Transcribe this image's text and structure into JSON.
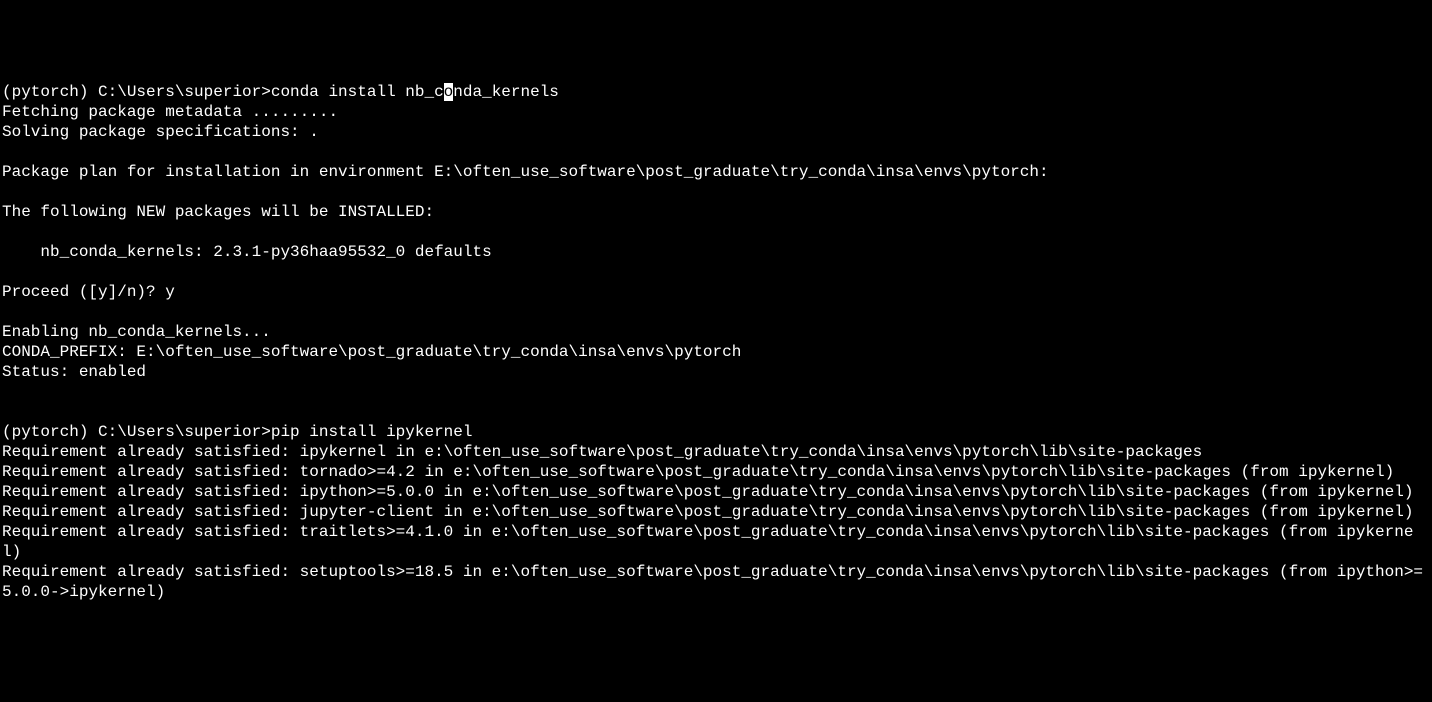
{
  "terminal": {
    "lines": [
      {
        "prompt": "(pytorch) C:\\Users\\superior>",
        "command_before_cursor": "conda install nb_c",
        "cursor_char": "o",
        "command_after_cursor": "nda_kernels"
      },
      {
        "text": "Fetching package metadata ........."
      },
      {
        "text": "Solving package specifications: ."
      },
      {
        "text": ""
      },
      {
        "text": "Package plan for installation in environment E:\\often_use_software\\post_graduate\\try_conda\\insa\\envs\\pytorch:"
      },
      {
        "text": ""
      },
      {
        "text": "The following NEW packages will be INSTALLED:"
      },
      {
        "text": ""
      },
      {
        "text": "    nb_conda_kernels: 2.3.1-py36haa95532_0 defaults"
      },
      {
        "text": ""
      },
      {
        "text": "Proceed ([y]/n)? y"
      },
      {
        "text": ""
      },
      {
        "text": "Enabling nb_conda_kernels..."
      },
      {
        "text": "CONDA_PREFIX: E:\\often_use_software\\post_graduate\\try_conda\\insa\\envs\\pytorch"
      },
      {
        "text": "Status: enabled"
      },
      {
        "text": ""
      },
      {
        "text": ""
      },
      {
        "prompt": "(pytorch) C:\\Users\\superior>",
        "command": "pip install ipykernel"
      },
      {
        "text": "Requirement already satisfied: ipykernel in e:\\often_use_software\\post_graduate\\try_conda\\insa\\envs\\pytorch\\lib\\site-packages"
      },
      {
        "text": "Requirement already satisfied: tornado>=4.2 in e:\\often_use_software\\post_graduate\\try_conda\\insa\\envs\\pytorch\\lib\\site-packages (from ipykernel)"
      },
      {
        "text": "Requirement already satisfied: ipython>=5.0.0 in e:\\often_use_software\\post_graduate\\try_conda\\insa\\envs\\pytorch\\lib\\site-packages (from ipykernel)"
      },
      {
        "text": "Requirement already satisfied: jupyter-client in e:\\often_use_software\\post_graduate\\try_conda\\insa\\envs\\pytorch\\lib\\site-packages (from ipykernel)"
      },
      {
        "text": "Requirement already satisfied: traitlets>=4.1.0 in e:\\often_use_software\\post_graduate\\try_conda\\insa\\envs\\pytorch\\lib\\site-packages (from ipykernel)"
      },
      {
        "text": "Requirement already satisfied: setuptools>=18.5 in e:\\often_use_software\\post_graduate\\try_conda\\insa\\envs\\pytorch\\lib\\site-packages (from ipython>=5.0.0->ipykernel)"
      }
    ]
  }
}
